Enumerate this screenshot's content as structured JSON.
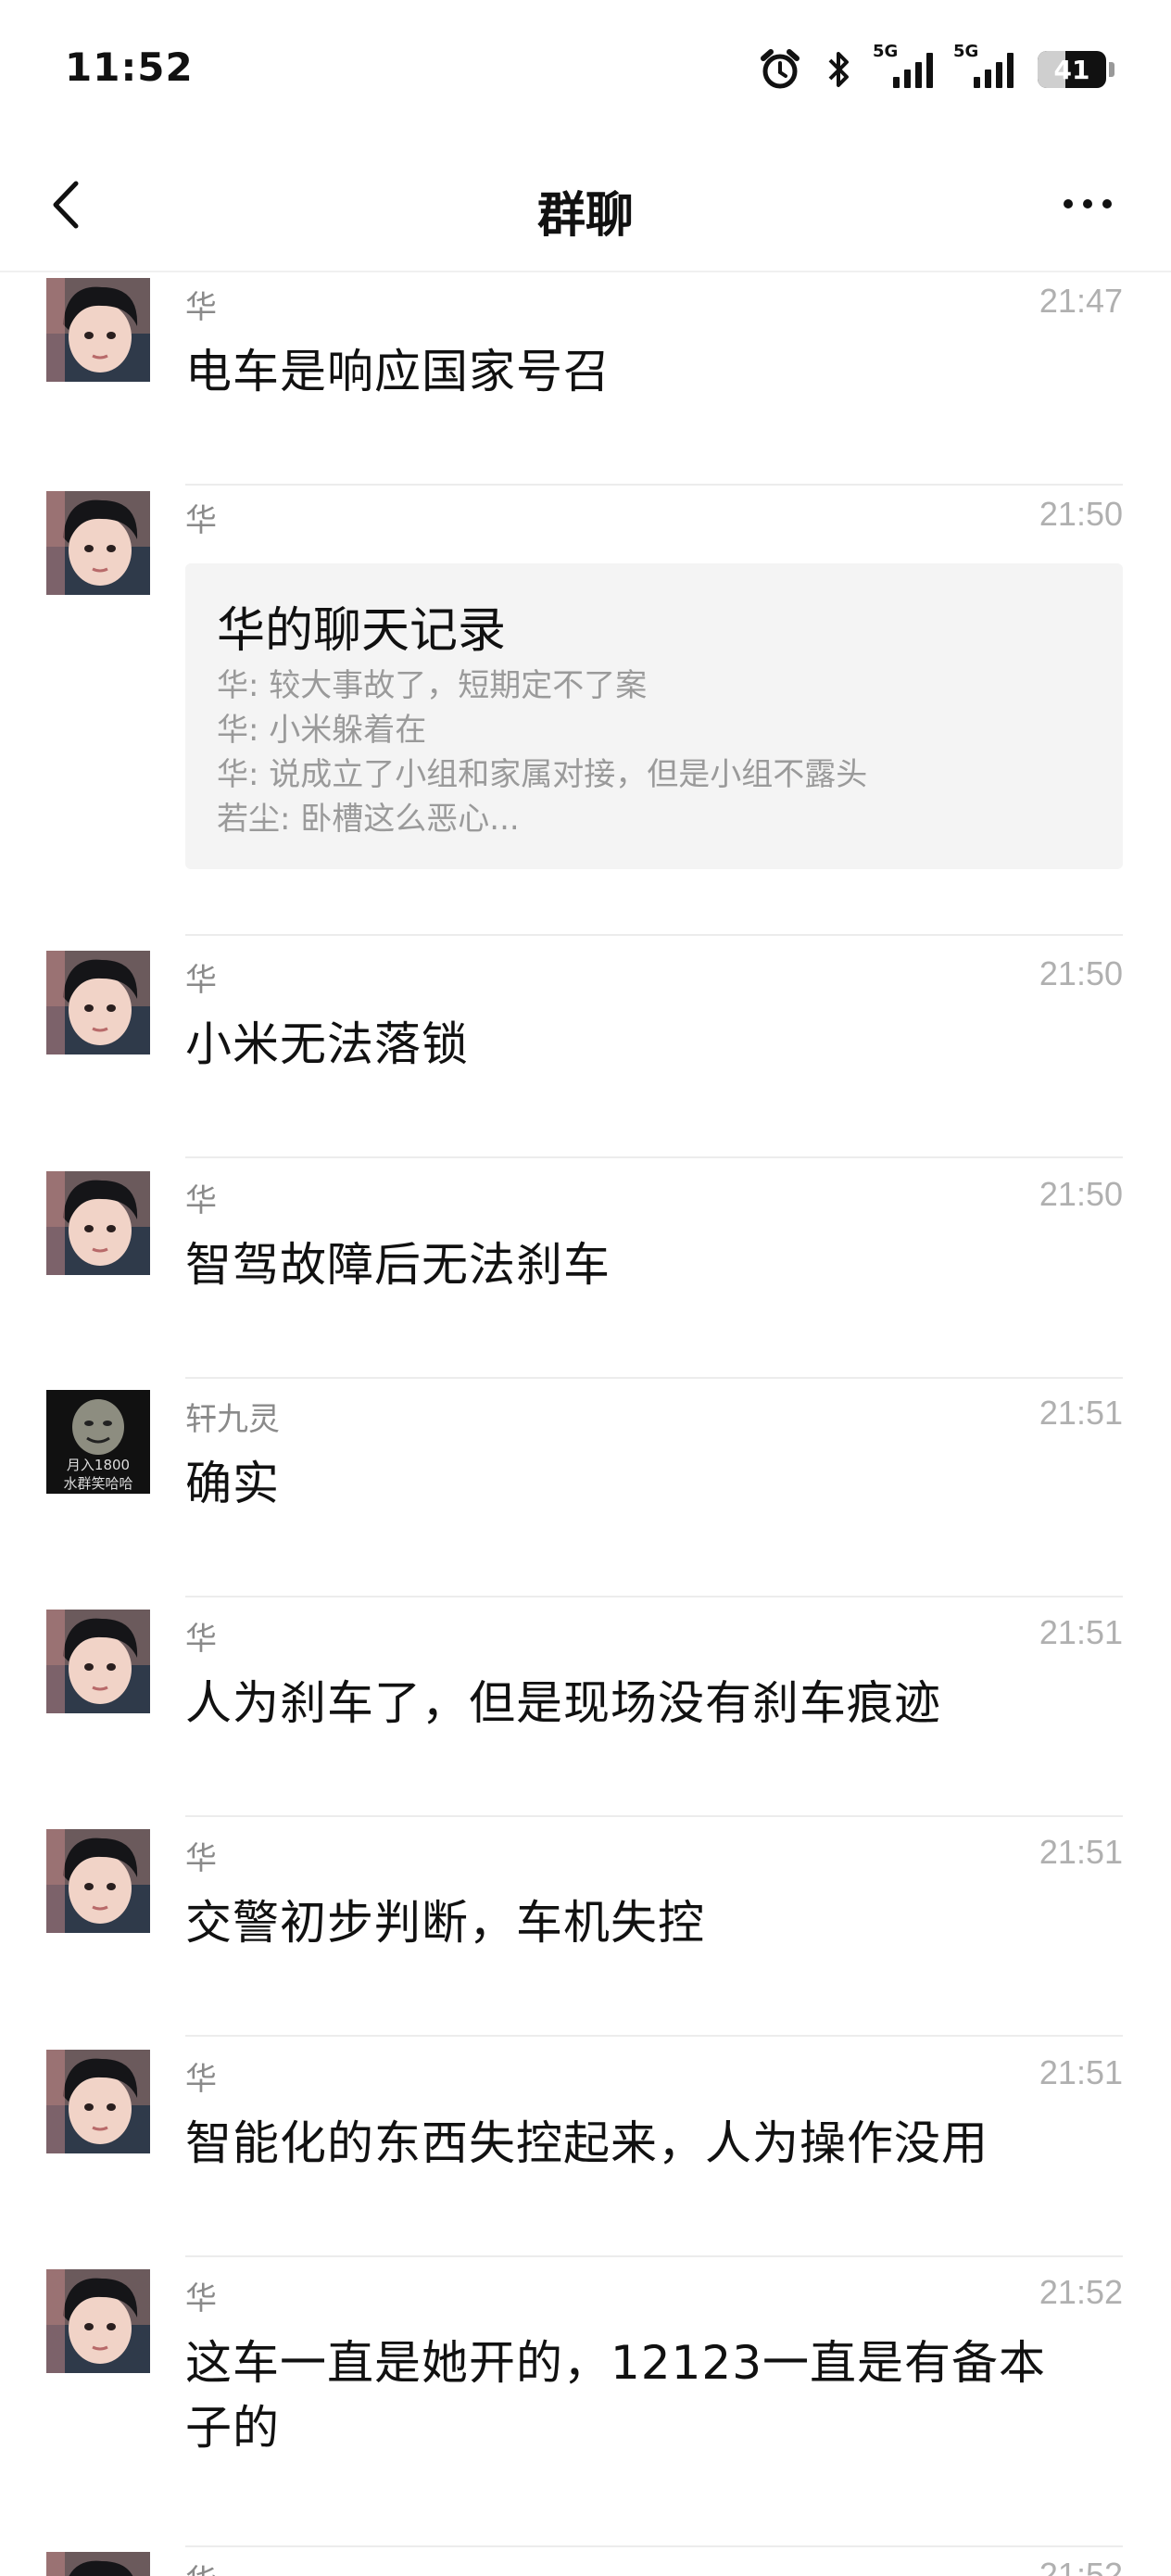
{
  "status_bar": {
    "time": "11:52",
    "network_1": "5G",
    "network_2": "5G",
    "battery": "41",
    "battery_level": 0.41
  },
  "header": {
    "title": "群聊"
  },
  "messages": [
    {
      "sender": "华",
      "time": "21:47",
      "text": "电车是响应国家号召",
      "avatar": "boy"
    },
    {
      "sender": "华",
      "time": "21:50",
      "type": "chat_record",
      "avatar": "boy",
      "record": {
        "title": "华的聊天记录",
        "lines": [
          "华: 较大事故了，短期定不了案",
          "华: 小米躲着在",
          "华: 说成立了小组和家属对接，但是小组不露头",
          "若尘: 卧槽这么恶心..."
        ]
      }
    },
    {
      "sender": "华",
      "time": "21:50",
      "text": "小米无法落锁",
      "avatar": "boy"
    },
    {
      "sender": "华",
      "time": "21:50",
      "text": "智驾故障后无法刹车",
      "avatar": "boy"
    },
    {
      "sender": "轩九灵",
      "time": "21:51",
      "text": "确实",
      "avatar": "meme",
      "avatar_caption": [
        "月入1800",
        "水群笑哈哈"
      ]
    },
    {
      "sender": "华",
      "time": "21:51",
      "text": "人为刹车了，但是现场没有刹车痕迹",
      "avatar": "boy"
    },
    {
      "sender": "华",
      "time": "21:51",
      "text": "交警初步判断，车机失控",
      "avatar": "boy"
    },
    {
      "sender": "华",
      "time": "21:51",
      "text": "智能化的东西失控起来，人为操作没用",
      "avatar": "boy"
    },
    {
      "sender": "华",
      "time": "21:52",
      "text": "这车一直是她开的，12123一直是有备本子的",
      "avatar": "boy"
    },
    {
      "sender": "华",
      "time": "21:52",
      "text": "",
      "avatar": "boy"
    }
  ]
}
